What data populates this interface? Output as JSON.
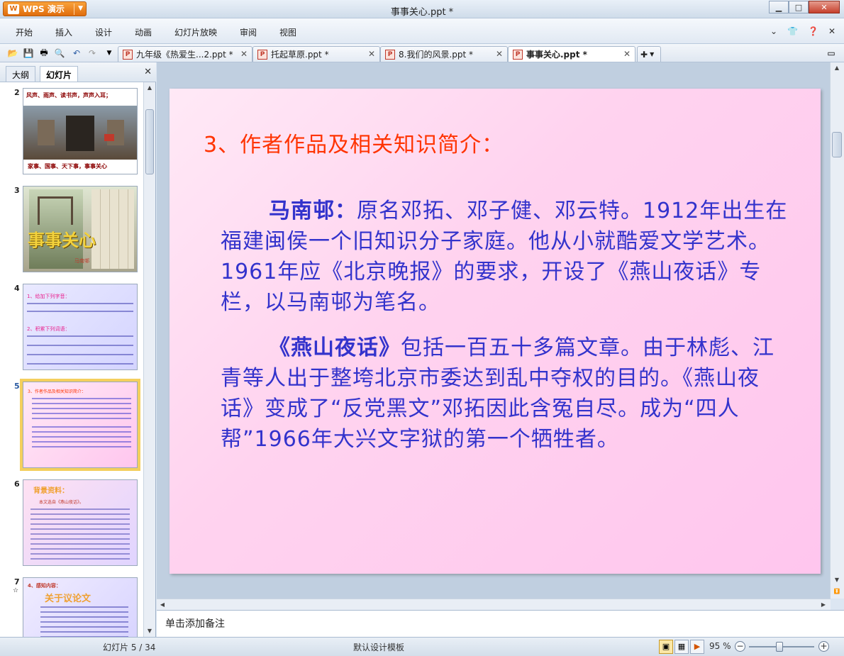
{
  "app": {
    "name": "WPS 演示",
    "doc_title": "事事关心.ppt *"
  },
  "menu": [
    "开始",
    "插入",
    "设计",
    "动画",
    "幻灯片放映",
    "审阅",
    "视图"
  ],
  "tabs": [
    {
      "label": "九年级《热爱生...2.ppt *"
    },
    {
      "label": "托起草原.ppt *"
    },
    {
      "label": "8.我们的风景.ppt *"
    },
    {
      "label": "事事关心.ppt *"
    }
  ],
  "left_panel": {
    "tab_outline": "大纲",
    "tab_slides": "幻灯片"
  },
  "thumbnails": [
    {
      "num": "2",
      "line1": "风声、雨声、读书声，声声入耳；",
      "line2": "家事、国事、天下事，事事关心"
    },
    {
      "num": "3",
      "title": "事事关心",
      "sub": "马南邨"
    },
    {
      "num": "4",
      "heading1": "1、给加下列字音：",
      "heading2": "2、积累下列词语："
    },
    {
      "num": "5",
      "heading": "3、作者作品及相关知识简介："
    },
    {
      "num": "6",
      "heading": "背景资料：",
      "sub": "本文选自《燕山夜话》。"
    },
    {
      "num": "7",
      "heading": "4、感知内容：",
      "sub": "关于议论文"
    }
  ],
  "slide": {
    "title": "3、作者作品及相关知识简介：",
    "p1_bold": "马南邨：",
    "p1_text": "原名邓拓、邓子健、邓云特。1912年出生在福建闽侯一个旧知识分子家庭。他从小就酷爱文学艺术。1961年应《北京晚报》的要求，开设了《燕山夜话》专栏，以马南邨为笔名。",
    "p2_bold": "《燕山夜话》",
    "p2_text": "包括一百五十多篇文章。由于林彪、江青等人出于整垮北京市委达到乱中夺权的目的。《燕山夜话》变成了“反党黑文”邓拓因此含冤自尽。成为“四人帮”1966年大兴文字狱的第一个牺牲者。"
  },
  "notes_placeholder": "单击添加备注",
  "status": {
    "slide_indicator": "幻灯片 5 / 34",
    "template": "默认设计模板",
    "zoom": "95 %"
  },
  "colors": {
    "slide_title": "#ff3300",
    "slide_text": "#3333cc",
    "selection": "#f4cf5d"
  }
}
